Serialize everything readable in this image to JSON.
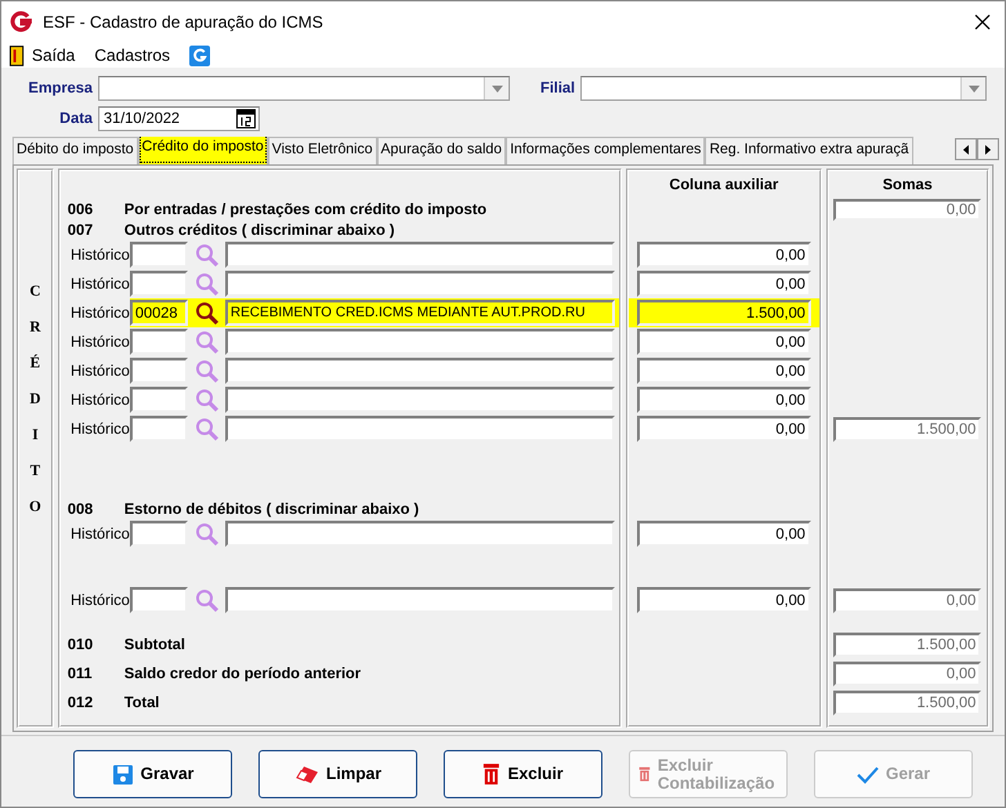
{
  "window": {
    "title": "ESF - Cadastro de apuração do ICMS"
  },
  "menu": [
    {
      "kind": "exit",
      "label": "Saída"
    },
    {
      "kind": "plain",
      "label": "Cadastros"
    },
    {
      "kind": "logo"
    }
  ],
  "form": {
    "empresa": {
      "label": "Empresa"
    },
    "filial": {
      "label": "Filial"
    },
    "data": {
      "label": "Data",
      "value": "31/10/2022"
    }
  },
  "tabs": [
    {
      "label": "Débito do imposto",
      "selected": false
    },
    {
      "label": "Crédito do imposto",
      "selected": true
    },
    {
      "label": "Visto Eletrônico",
      "selected": false
    },
    {
      "label": "Apuração do saldo",
      "selected": false
    },
    {
      "label": "Informações complementares",
      "selected": false
    },
    {
      "label": "Reg. Informativo extra apuraçã",
      "selected": false
    }
  ],
  "panel": {
    "side_label": "CRÉDITO",
    "aux_heading": "Coluna auxiliar",
    "somas_heading": "Somas",
    "lines": [
      {
        "kind": "section",
        "code": "006",
        "label": "Por entradas / prestações com crédito do imposto",
        "somas": "0,00"
      },
      {
        "kind": "section",
        "code": "007",
        "label": "Outros créditos ( discriminar abaixo )"
      },
      {
        "kind": "historico",
        "label": "Histórico",
        "aux": "0,00",
        "highlighted": false
      },
      {
        "kind": "historico",
        "label": "Histórico",
        "aux": "0,00",
        "highlighted": false
      },
      {
        "kind": "historico",
        "label": "Histórico",
        "code": "00028",
        "description": "RECEBIMENTO CRED.ICMS MEDIANTE AUT.PROD.RU",
        "aux": "1.500,00",
        "highlighted": true
      },
      {
        "kind": "historico",
        "label": "Histórico",
        "aux": "0,00",
        "highlighted": false
      },
      {
        "kind": "historico",
        "label": "Histórico",
        "aux": "0,00",
        "highlighted": false
      },
      {
        "kind": "historico",
        "label": "Histórico",
        "aux": "0,00",
        "highlighted": false
      },
      {
        "kind": "historico",
        "label": "Histórico",
        "aux": "0,00",
        "highlighted": false,
        "somas": "1.500,00"
      },
      {
        "kind": "section",
        "code": "008",
        "label": "Estorno de débitos ( discriminar abaixo )"
      },
      {
        "kind": "historico",
        "label": "Histórico",
        "aux": "0,00",
        "highlighted": false
      },
      {
        "kind": "historico",
        "label": "Histórico",
        "aux": "0,00",
        "highlighted": false,
        "somas": "0,00"
      },
      {
        "kind": "total",
        "code": "010",
        "label": "Subtotal",
        "somas": "1.500,00"
      },
      {
        "kind": "total",
        "code": "011",
        "label": "Saldo credor do período anterior",
        "somas": "0,00"
      },
      {
        "kind": "total",
        "code": "012",
        "label": "Total",
        "somas": "1.500,00"
      }
    ]
  },
  "buttons": [
    {
      "kind": "save",
      "label": "Gravar",
      "disabled": false
    },
    {
      "kind": "eraser",
      "label": "Limpar",
      "disabled": false
    },
    {
      "kind": "trash",
      "label": "Excluir",
      "disabled": false
    },
    {
      "kind": "trash",
      "label": "Excluir Contabilização",
      "disabled": true
    },
    {
      "kind": "check",
      "label": "Gerar",
      "disabled": true
    }
  ]
}
